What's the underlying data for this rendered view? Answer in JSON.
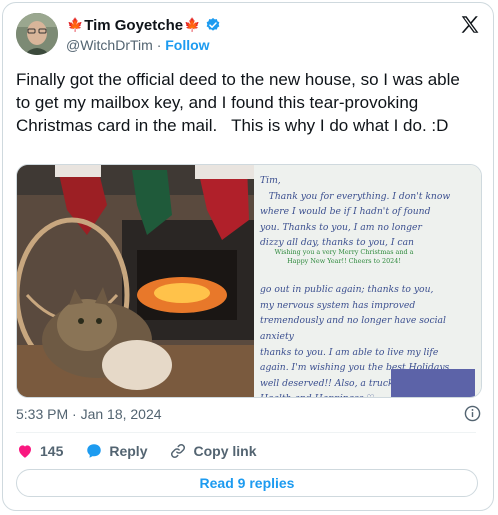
{
  "author": {
    "flag_left": "🍁",
    "display_name": "Tim Goyetche",
    "flag_right": "🍁",
    "handle": "@WitchDrTim",
    "separator": "·",
    "follow_label": "Follow"
  },
  "tweet": {
    "text": "Finally got the official deed to the new house, so I was able to get my mailbox key, and I found this tear-provoking Christmas card in the mail.   This is why I do what I do. :D",
    "timestamp": "5:33 PM · Jan 18, 2024"
  },
  "card": {
    "handwriting": "Tim,\n   Thank you for everything. I don't know\nwhere I would be if I hadn't of found\nyou. Thanks to you, I am no longer\ndizzy all day, thanks to you, I can\n\n\ngo out in public again; thanks to you,\nmy nervous system has improved\ntremendously and no longer have social anxiety\nthanks to you. I am able to live my life\nagain. I'm wishing you the best Holidays\nwell deserved!! Also, a truck load of\nHealth and Happiness ♡",
    "printed_greeting": "Wishing you a very Merry Christmas and a\nHappy New Year!!\nCheers to 2024!"
  },
  "actions": {
    "like_count": "145",
    "reply_label": "Reply",
    "copy_link_label": "Copy link"
  },
  "read_replies_label": "Read 9 replies",
  "colors": {
    "accent": "#1d9bf0",
    "like": "#f91880",
    "text": "#0f1419",
    "muted": "#536471",
    "border": "#cfd9de"
  },
  "icons": [
    "verified-badge-icon",
    "x-logo-icon",
    "info-icon",
    "heart-icon",
    "reply-bubble-icon",
    "link-icon"
  ]
}
